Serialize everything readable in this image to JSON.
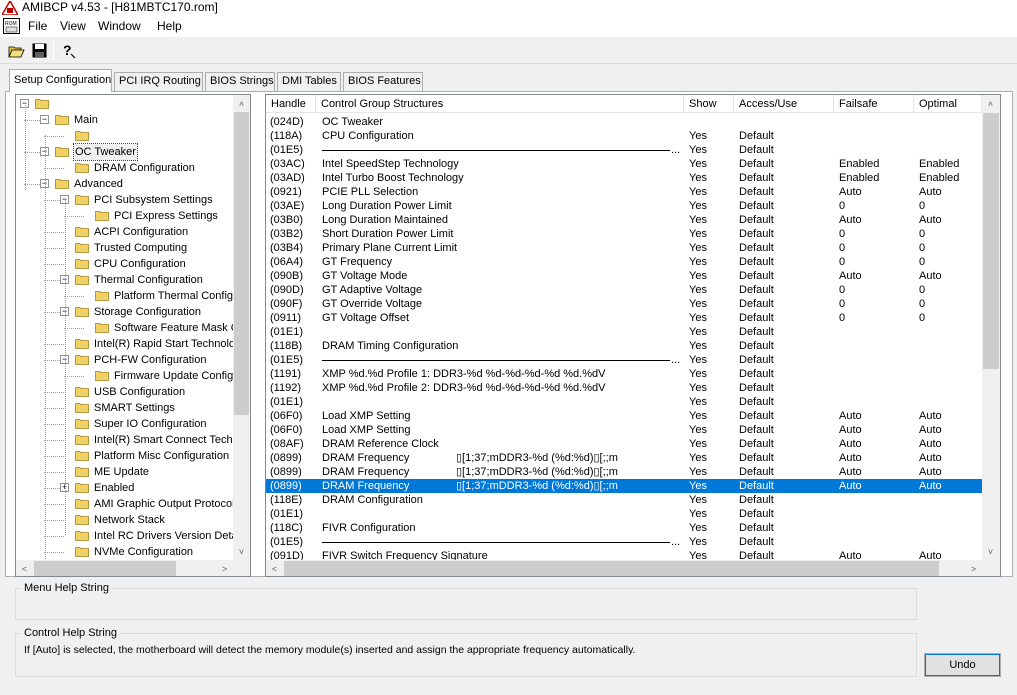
{
  "window": {
    "title": "AMIBCP v4.53 - [H81MBTC170.rom]",
    "icon": "rom-icon"
  },
  "menu": {
    "items": [
      "File",
      "View",
      "Window",
      "Help"
    ]
  },
  "toolbar": {
    "buttons": [
      "open-folder-icon",
      "save-icon",
      "help-icon"
    ]
  },
  "tabs": [
    "Setup Configuration",
    "PCI IRQ Routing",
    "BIOS Strings",
    "DMI Tables",
    "BIOS Features"
  ],
  "active_tab": "Setup Configuration",
  "tree": {
    "items": [
      {
        "label": "",
        "level": 0,
        "expander": "minus"
      },
      {
        "label": "Main",
        "level": 1,
        "expander": "minus"
      },
      {
        "label": "",
        "level": 2,
        "expander": ""
      },
      {
        "label": "OC Tweaker",
        "level": 1,
        "expander": "minus",
        "highlight": true
      },
      {
        "label": "DRAM Configuration",
        "level": 2,
        "expander": ""
      },
      {
        "label": "Advanced",
        "level": 1,
        "expander": "minus"
      },
      {
        "label": "PCI Subsystem Settings",
        "level": 2,
        "expander": "minus"
      },
      {
        "label": "PCI Express Settings",
        "level": 3,
        "expander": ""
      },
      {
        "label": "ACPI Configuration",
        "level": 2,
        "expander": ""
      },
      {
        "label": "Trusted Computing",
        "level": 2,
        "expander": ""
      },
      {
        "label": "CPU Configuration",
        "level": 2,
        "expander": ""
      },
      {
        "label": "Thermal Configuration",
        "level": 2,
        "expander": "minus"
      },
      {
        "label": "Platform Thermal Configu",
        "level": 3,
        "expander": ""
      },
      {
        "label": "Storage Configuration",
        "level": 2,
        "expander": "minus"
      },
      {
        "label": "Software Feature Mask C",
        "level": 3,
        "expander": ""
      },
      {
        "label": "Intel(R) Rapid Start Technolo",
        "level": 2,
        "expander": ""
      },
      {
        "label": "PCH-FW Configuration",
        "level": 2,
        "expander": "minus"
      },
      {
        "label": "Firmware Update Configu",
        "level": 3,
        "expander": ""
      },
      {
        "label": "USB Configuration",
        "level": 2,
        "expander": ""
      },
      {
        "label": "SMART Settings",
        "level": 2,
        "expander": ""
      },
      {
        "label": "Super IO Configuration",
        "level": 2,
        "expander": ""
      },
      {
        "label": "Intel(R) Smart Connect Techr",
        "level": 2,
        "expander": ""
      },
      {
        "label": "Platform Misc Configuration",
        "level": 2,
        "expander": ""
      },
      {
        "label": "ME Update",
        "level": 2,
        "expander": ""
      },
      {
        "label": "Enabled",
        "level": 2,
        "expander": "plus"
      },
      {
        "label": "AMI Graphic Output Protocol",
        "level": 2,
        "expander": ""
      },
      {
        "label": "Network Stack",
        "level": 2,
        "expander": ""
      },
      {
        "label": "Intel RC Drivers Version Deta",
        "level": 2,
        "expander": ""
      },
      {
        "label": "NVMe Configuration",
        "level": 2,
        "expander": ""
      }
    ]
  },
  "table": {
    "headers": [
      "Handle",
      "Control Group Structures",
      "Show",
      "Access/Use",
      "Failsafe",
      "Optimal"
    ],
    "rows": [
      {
        "handle": "(024D)",
        "name": "OC Tweaker",
        "show": "",
        "access": "",
        "failsafe": "",
        "optimal": ""
      },
      {
        "handle": "(118A)",
        "name": "CPU Configuration",
        "show": "Yes",
        "access": "Default",
        "failsafe": "",
        "optimal": ""
      },
      {
        "handle": "(01E5)",
        "name": "",
        "sep": true,
        "show": "Yes",
        "access": "Default",
        "failsafe": "",
        "optimal": ""
      },
      {
        "handle": "(03AC)",
        "name": "Intel SpeedStep Technology",
        "show": "Yes",
        "access": "Default",
        "failsafe": "Enabled",
        "optimal": "Enabled"
      },
      {
        "handle": "(03AD)",
        "name": "Intel Turbo Boost Technology",
        "show": "Yes",
        "access": "Default",
        "failsafe": "Enabled",
        "optimal": "Enabled"
      },
      {
        "handle": "(0921)",
        "name": "PCIE PLL Selection",
        "show": "Yes",
        "access": "Default",
        "failsafe": "Auto",
        "optimal": "Auto"
      },
      {
        "handle": "(03AE)",
        "name": "Long Duration Power Limit",
        "show": "Yes",
        "access": "Default",
        "failsafe": "0",
        "optimal": "0"
      },
      {
        "handle": "(03B0)",
        "name": "Long Duration Maintained",
        "show": "Yes",
        "access": "Default",
        "failsafe": "Auto",
        "optimal": "Auto"
      },
      {
        "handle": "(03B2)",
        "name": "Short Duration Power Limit",
        "show": "Yes",
        "access": "Default",
        "failsafe": "0",
        "optimal": "0"
      },
      {
        "handle": "(03B4)",
        "name": "Primary Plane Current Limit",
        "show": "Yes",
        "access": "Default",
        "failsafe": "0",
        "optimal": "0"
      },
      {
        "handle": "(06A4)",
        "name": "GT Frequency",
        "show": "Yes",
        "access": "Default",
        "failsafe": "0",
        "optimal": "0"
      },
      {
        "handle": "(090B)",
        "name": "GT Voltage Mode",
        "show": "Yes",
        "access": "Default",
        "failsafe": "Auto",
        "optimal": "Auto"
      },
      {
        "handle": "(090D)",
        "name": "GT Adaptive Voltage",
        "show": "Yes",
        "access": "Default",
        "failsafe": "0",
        "optimal": "0"
      },
      {
        "handle": "(090F)",
        "name": "GT Override Voltage",
        "show": "Yes",
        "access": "Default",
        "failsafe": "0",
        "optimal": "0"
      },
      {
        "handle": "(0911)",
        "name": "GT Voltage Offset",
        "show": "Yes",
        "access": "Default",
        "failsafe": "0",
        "optimal": "0"
      },
      {
        "handle": "(01E1)",
        "name": "",
        "show": "Yes",
        "access": "Default",
        "failsafe": "",
        "optimal": ""
      },
      {
        "handle": "(118B)",
        "name": "DRAM Timing Configuration",
        "show": "Yes",
        "access": "Default",
        "failsafe": "",
        "optimal": ""
      },
      {
        "handle": "(01E5)",
        "name": "",
        "sep": true,
        "show": "Yes",
        "access": "Default",
        "failsafe": "",
        "optimal": ""
      },
      {
        "handle": "(1191)",
        "name": "XMP %d.%d Profile 1: DDR3-%d %d-%d-%d-%d %d.%dV",
        "show": "Yes",
        "access": "Default",
        "failsafe": "",
        "optimal": ""
      },
      {
        "handle": "(1192)",
        "name": "XMP %d.%d Profile 2: DDR3-%d %d-%d-%d-%d %d.%dV",
        "show": "Yes",
        "access": "Default",
        "failsafe": "",
        "optimal": ""
      },
      {
        "handle": "(01E1)",
        "name": "",
        "show": "Yes",
        "access": "Default",
        "failsafe": "",
        "optimal": ""
      },
      {
        "handle": "(06F0)",
        "name": "Load XMP Setting",
        "show": "Yes",
        "access": "Default",
        "failsafe": "Auto",
        "optimal": "Auto"
      },
      {
        "handle": "(06F0)",
        "name": "Load XMP Setting",
        "show": "Yes",
        "access": "Default",
        "failsafe": "Auto",
        "optimal": "Auto"
      },
      {
        "handle": "(08AF)",
        "name": "DRAM Reference Clock",
        "show": "Yes",
        "access": "Default",
        "failsafe": "Auto",
        "optimal": "Auto"
      },
      {
        "handle": "(0899)",
        "name": "DRAM Frequency",
        "extra": "\u0000[1;37;mDDR3-%d (%d:%d)\u0000[;;m",
        "show": "Yes",
        "access": "Default",
        "failsafe": "Auto",
        "optimal": "Auto"
      },
      {
        "handle": "(0899)",
        "name": "DRAM Frequency",
        "extra": "\u0000[1;37;mDDR3-%d (%d:%d)\u0000[;;m",
        "show": "Yes",
        "access": "Default",
        "failsafe": "Auto",
        "optimal": "Auto"
      },
      {
        "handle": "(0899)",
        "name": "DRAM Frequency",
        "extra": "\u0000[1;37;mDDR3-%d (%d:%d)\u0000[;;m",
        "show": "Yes",
        "access": "Default",
        "failsafe": "Auto",
        "optimal": "Auto",
        "selected": true
      },
      {
        "handle": "(118E)",
        "name": "DRAM Configuration",
        "show": "Yes",
        "access": "Default",
        "failsafe": "",
        "optimal": ""
      },
      {
        "handle": "(01E1)",
        "name": "",
        "show": "Yes",
        "access": "Default",
        "failsafe": "",
        "optimal": ""
      },
      {
        "handle": "(118C)",
        "name": "FIVR Configuration",
        "show": "Yes",
        "access": "Default",
        "failsafe": "",
        "optimal": ""
      },
      {
        "handle": "(01E5)",
        "name": "",
        "sep": true,
        "show": "Yes",
        "access": "Default",
        "failsafe": "",
        "optimal": ""
      },
      {
        "handle": "(091D)",
        "name": "FIVR Switch Frequency Signature",
        "show": "Yes",
        "access": "Default",
        "failsafe": "Auto",
        "optimal": "Auto"
      }
    ]
  },
  "menu_help": {
    "title": "Menu Help String",
    "text": ""
  },
  "control_help": {
    "title": "Control Help String",
    "text": "If [Auto] is selected, the motherboard will detect the memory module(s) inserted and assign the appropriate frequency automatically."
  },
  "undo_label": "Undo",
  "colors": {
    "selection": "#0078d7",
    "folder": "#f0d264",
    "background": "#f0f0f0"
  }
}
